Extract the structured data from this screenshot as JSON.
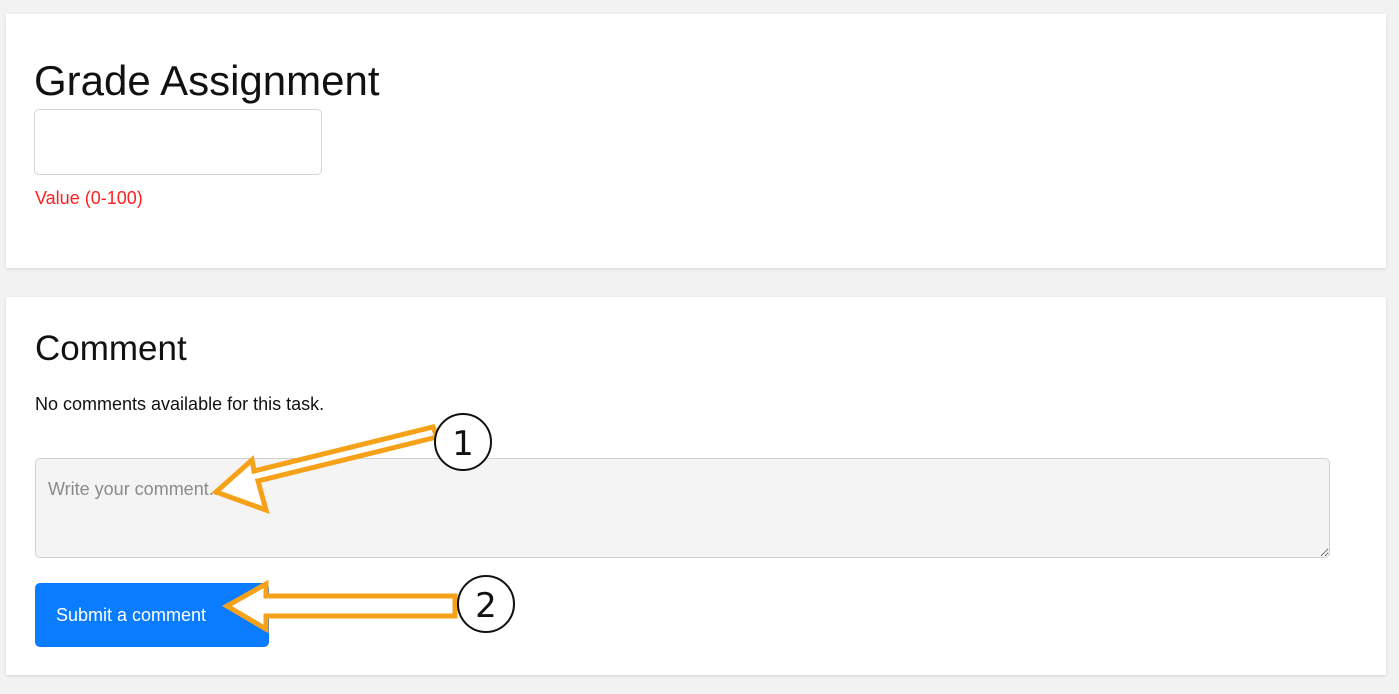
{
  "grade": {
    "title": "Grade Assignment",
    "input_value": "",
    "hint": "Value (0-100)"
  },
  "comment": {
    "title": "Comment",
    "empty_message": "No comments available for this task.",
    "textarea_placeholder": "Write your comment...",
    "submit_label": "Submit a comment"
  },
  "annotations": {
    "arrow_color": "#f5a21a",
    "step1_label": "1",
    "step2_label": "2"
  },
  "colors": {
    "primary_button": "#0a7cff",
    "hint_text": "#ff1f1f",
    "page_background": "#f2f2f2"
  }
}
